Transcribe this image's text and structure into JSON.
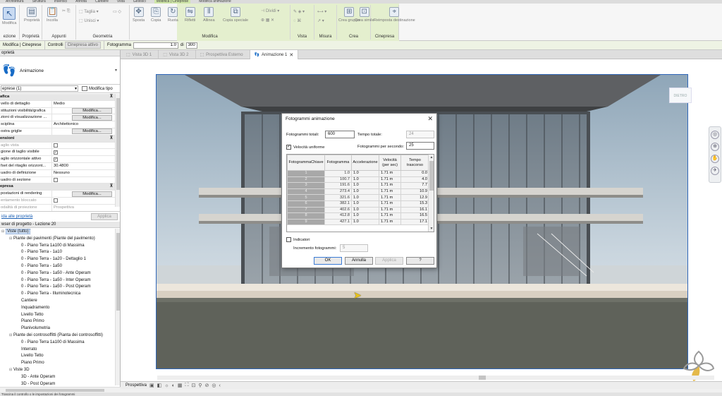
{
  "ribbon_tabs": [
    "Architettura",
    "Struttura",
    "Inserisci",
    "Annota",
    "Cantiere",
    "Vista",
    "Gestisci",
    "Modifica | Cineprese",
    "Modifica animazione"
  ],
  "ribbon": {
    "groups": {
      "selection": "ezione",
      "properties": "Proprietà",
      "clipboard": "Appunti",
      "geometry": "Geometria",
      "modify": "Modifica",
      "view": "Vista",
      "measure": "Misura",
      "create": "Crea",
      "camera": "Cinepresa"
    },
    "buttons": {
      "modify": "Modifica",
      "properties": "Proprietà",
      "paste": "Incolla",
      "cut": "Taglia",
      "join": "Unisci",
      "move": "Sposta",
      "copy": "Copia",
      "rotate": "Ruota",
      "mirror": "Rifletti",
      "align": "Allinea",
      "copy_special": "Copia speciale",
      "split": "Dividi",
      "create_group": "Crea gruppo",
      "create_similar": "Crea simile",
      "reset_target": "Reimposta destinazione"
    }
  },
  "optbar": {
    "context": "Modifica | Cineprese",
    "controls_label": "Controlli",
    "controls_value": "Cinepresa attivo",
    "frame_label": "Fotogramma",
    "frame_value": "1.0",
    "of_label": "di",
    "total_frames": "300"
  },
  "properties": {
    "title": "oprietà",
    "type_name": "Animazione",
    "instance_selector": "eprese (1)",
    "edit_type": "Modifica tipo",
    "rows": [
      {
        "kind": "section",
        "k": "afica"
      },
      {
        "kind": "text",
        "k": "vello di dettaglio",
        "v": "Medio"
      },
      {
        "kind": "button",
        "k": "stituzioni visibilità/grafica",
        "v": "Modifica..."
      },
      {
        "kind": "button",
        "k": "zioni di visualizzazione ...",
        "v": "Modifica..."
      },
      {
        "kind": "text",
        "k": "sciplina",
        "v": "Architettonico"
      },
      {
        "kind": "button",
        "k": "ostra griglie",
        "v": "Modifica..."
      },
      {
        "kind": "section",
        "k": "ensioni"
      },
      {
        "kind": "check",
        "k": "aglio vista",
        "v": "",
        "muted": true
      },
      {
        "kind": "check",
        "k": "gione di taglio visibile",
        "v": "✓"
      },
      {
        "kind": "check",
        "k": "aglio orizzontale attivo",
        "v": "✓"
      },
      {
        "kind": "text",
        "k": "fset del ritaglio orizzont...",
        "v": "30.4800"
      },
      {
        "kind": "text",
        "k": "uadro di definizione",
        "v": "Nessuno"
      },
      {
        "kind": "check",
        "k": "uadro di sezione",
        "v": ""
      },
      {
        "kind": "section",
        "k": "epresa"
      },
      {
        "kind": "button",
        "k": "postazioni di rendering",
        "v": "Modifica..."
      },
      {
        "kind": "check",
        "k": "entamento bloccato",
        "v": "",
        "muted": true
      },
      {
        "kind": "text",
        "k": "odalità di proiezione",
        "v": "Prospettiva",
        "muted": true
      }
    ],
    "help_link": "ida alle proprietà",
    "apply": "Applica"
  },
  "project_browser": {
    "title": "wser di progetto - Lezione 20",
    "nodes": [
      {
        "label": "Viste (tutto)",
        "level": 0,
        "toggle": "⊟",
        "selected": true
      },
      {
        "label": "Piante dei pavimenti (Piante del pavimento)",
        "level": 1,
        "toggle": "⊟"
      },
      {
        "label": "0 - Piano Terra 1a100 di Massima",
        "level": 2,
        "toggle": ""
      },
      {
        "label": "0 - Piano Terra - 1a10",
        "level": 2,
        "toggle": ""
      },
      {
        "label": "0 - Piano Terra - 1a20 - Dettaglio 1",
        "level": 2,
        "toggle": ""
      },
      {
        "label": "0 - Piano Terra - 1a50",
        "level": 2,
        "toggle": ""
      },
      {
        "label": "0 - Piano Terra - 1a50 - Ante Operam",
        "level": 2,
        "toggle": ""
      },
      {
        "label": "0 - Piano Terra - 1a50 - Inter Operam",
        "level": 2,
        "toggle": ""
      },
      {
        "label": "0 - Piano Terra - 1a50 - Post Operam",
        "level": 2,
        "toggle": ""
      },
      {
        "label": "0 - Piano Terra - Illuminotecnica",
        "level": 2,
        "toggle": ""
      },
      {
        "label": "Cantiere",
        "level": 2,
        "toggle": ""
      },
      {
        "label": "Inquadramento",
        "level": 2,
        "toggle": ""
      },
      {
        "label": "Livello Tetto",
        "level": 2,
        "toggle": ""
      },
      {
        "label": "Piano Primo",
        "level": 2,
        "toggle": ""
      },
      {
        "label": "Planivolumetria",
        "level": 2,
        "toggle": ""
      },
      {
        "label": "Piante dei controsoffitti (Pianta dei controsoffitti)",
        "level": 1,
        "toggle": "⊟"
      },
      {
        "label": "0 - Piano Terra 1a100 di Massima",
        "level": 2,
        "toggle": ""
      },
      {
        "label": "Interrato",
        "level": 2,
        "toggle": ""
      },
      {
        "label": "Livello Tetto",
        "level": 2,
        "toggle": ""
      },
      {
        "label": "Piano Primo",
        "level": 2,
        "toggle": ""
      },
      {
        "label": "Viste 3D",
        "level": 1,
        "toggle": "⊟"
      },
      {
        "label": "3D - Ante Operam",
        "level": 2,
        "toggle": ""
      },
      {
        "label": "3D - Post Operam",
        "level": 2,
        "toggle": ""
      }
    ]
  },
  "view_tabs": [
    {
      "label": "Vista 3D 1",
      "active": false
    },
    {
      "label": "Vista 3D 2",
      "active": false
    },
    {
      "label": "Prospettiva Esterno",
      "active": false
    },
    {
      "label": "Animazione 1",
      "active": true
    }
  ],
  "canvas": {
    "viewcube_label": "DIETRO",
    "view_scale": "Prospettiva"
  },
  "dialog": {
    "title": "Fotogrammi animazione",
    "total_frames_label": "Fotogrammi totali:",
    "total_frames_value": "600",
    "total_time_label": "Tempo totale:",
    "total_time_value": "24",
    "uniform_speed_label": "Velocità uniforme",
    "fps_label": "Fotogrammi per secondo:",
    "fps_value": "25",
    "columns": [
      "FotogrammaChiave",
      "Fotogramma",
      "Accelerazione",
      "Velocità (per sec)",
      "Tempo trascorso"
    ],
    "rows": [
      [
        "1",
        "1.0",
        "1.0",
        "1.71 m",
        "0.0"
      ],
      [
        "2",
        "100.7",
        "1.0",
        "1.71 m",
        "4.0"
      ],
      [
        "3",
        "191.6",
        "1.0",
        "1.71 m",
        "7.7"
      ],
      [
        "4",
        "273.4",
        "1.0",
        "1.71 m",
        "10.9"
      ],
      [
        "5",
        "321.6",
        "1.0",
        "1.71 m",
        "12.9"
      ],
      [
        "6",
        "382.1",
        "1.0",
        "1.71 m",
        "15.3"
      ],
      [
        "7",
        "402.6",
        "1.0",
        "1.71 m",
        "16.1"
      ],
      [
        "8",
        "412.8",
        "1.0",
        "1.71 m",
        "16.5"
      ],
      [
        "9",
        "427.1",
        "1.0",
        "1.71 m",
        "17.1"
      ]
    ],
    "indicators_label": "Indicatori",
    "frame_increment_label": "Incremento fotogrammi:",
    "frame_increment_value": "5",
    "ok": "OK",
    "cancel": "Annulla",
    "apply": "Applica",
    "help": "?"
  },
  "status_text": "Trascina il controllo o le impostazioni dei fotogrammi",
  "colors": {
    "context_tab": "#cfe6a8",
    "crop_border": "#2f66b8",
    "logo_gold": "#e4b94a"
  }
}
